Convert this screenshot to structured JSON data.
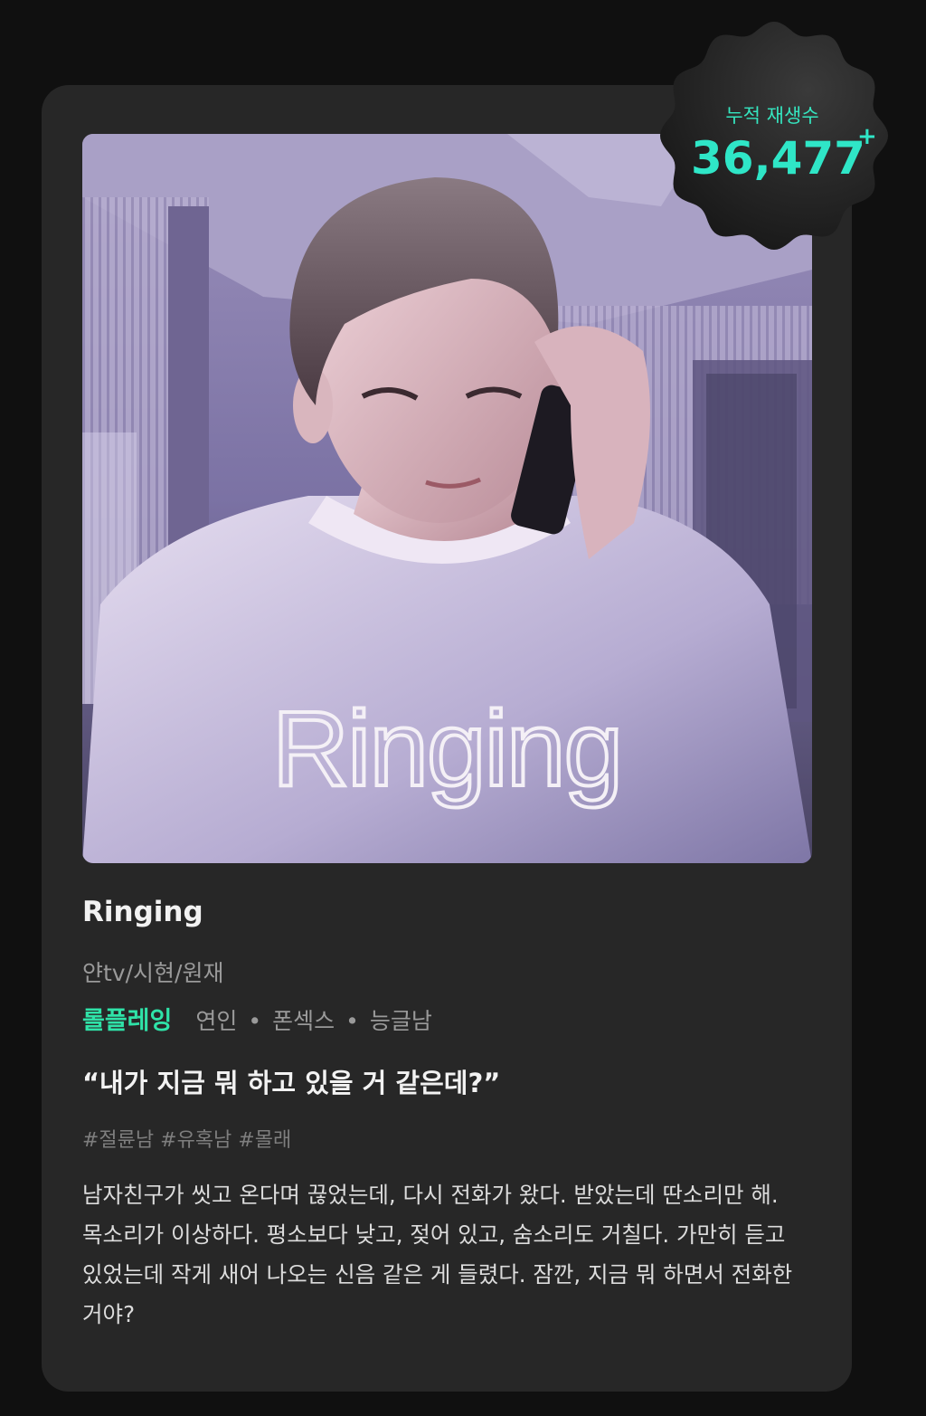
{
  "badge": {
    "label": "누적 재생수",
    "value": "36,477",
    "plus": "+"
  },
  "cover": {
    "title_text": "Ringing"
  },
  "content": {
    "title": "Ringing",
    "authors": "얀tv/시현/원재",
    "genre": "롤플레잉",
    "tags": [
      "연인",
      "폰섹스",
      "능글남"
    ],
    "separator": "•",
    "quote": "“내가 지금 뭐 하고 있을 거 같은데?”",
    "hashtags": "#절륜남 #유혹남 #몰래",
    "description": "남자친구가 씻고 온다며 끊었는데, 다시 전화가 왔다. 받았는데 딴소리만 해. 목소리가 이상하다. 평소보다 낮고, 젖어 있고, 숨소리도 거칠다. 가만히 듣고 있었는데 작게 새어 나오는 신음 같은 게 들렸다. 잠깐, 지금 뭐 하면서 전화한 거야?"
  },
  "colors": {
    "background": "#101010",
    "card": "#272727",
    "accent_green": "#2fe3a8",
    "accent_teal": "#2fe6c7"
  }
}
